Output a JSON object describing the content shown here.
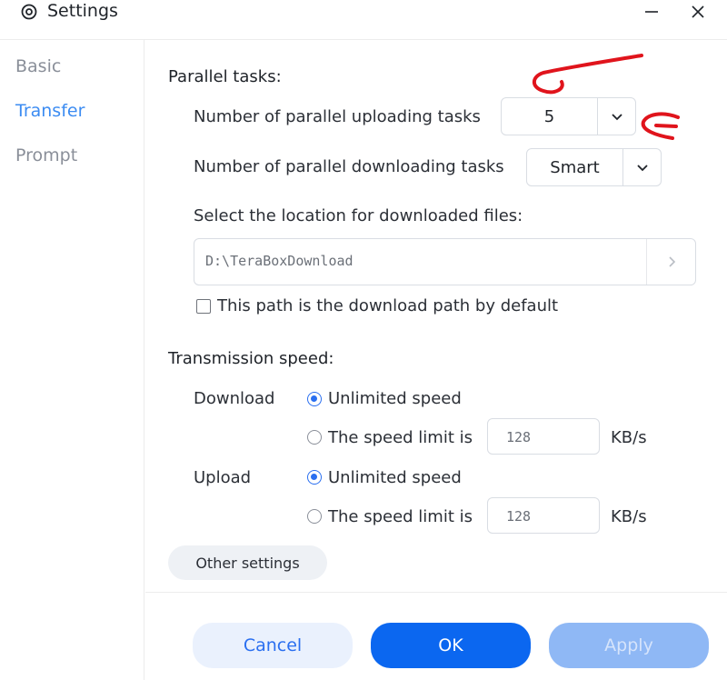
{
  "window": {
    "title": "Settings",
    "minimize_icon": "minimize-icon",
    "close_icon": "close-icon"
  },
  "sidebar": {
    "items": [
      {
        "label": "Basic",
        "active": false
      },
      {
        "label": "Transfer",
        "active": true
      },
      {
        "label": "Prompt",
        "active": false
      }
    ]
  },
  "parallel": {
    "section_title": "Parallel tasks:",
    "upload_label": "Number of parallel uploading tasks",
    "upload_value": "5",
    "download_label": "Number of parallel downloading tasks",
    "download_value": "Smart"
  },
  "location": {
    "label": "Select the location for downloaded files:",
    "path": "D:\\TeraBoxDownload",
    "default_checkbox_label": "This path is the download path by default",
    "default_checked": false
  },
  "speed": {
    "section_title": "Transmission speed:",
    "download": {
      "label": "Download",
      "unlimited_label": "Unlimited speed",
      "limit_label": "The speed limit is",
      "limit_value": "128",
      "unit": "KB/s",
      "selected": "unlimited"
    },
    "upload": {
      "label": "Upload",
      "unlimited_label": "Unlimited speed",
      "limit_label": "The speed limit is",
      "limit_value": "128",
      "unit": "KB/s",
      "selected": "unlimited"
    }
  },
  "other_settings_label": "Other settings",
  "footer": {
    "cancel_label": "Cancel",
    "ok_label": "OK",
    "apply_label": "Apply"
  },
  "colors": {
    "accent": "#0b67f0",
    "active_nav": "#3c8cf2",
    "annotation": "#e0141c"
  }
}
